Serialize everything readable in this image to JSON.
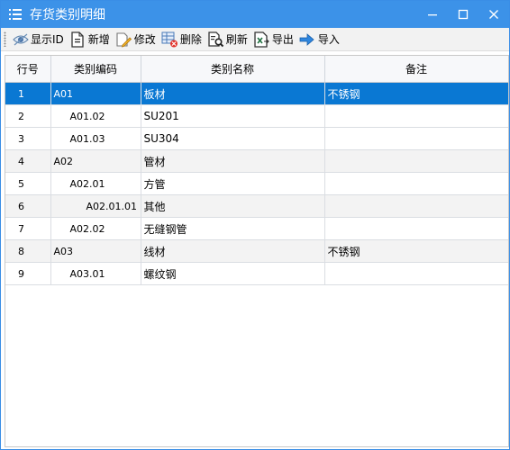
{
  "window": {
    "title": "存货类别明细",
    "accent": "#3c92e8"
  },
  "toolbar": {
    "show_id": "显示ID",
    "add": "新增",
    "edit": "修改",
    "delete": "删除",
    "refresh": "刷新",
    "export": "导出",
    "import": "导入"
  },
  "grid": {
    "columns": [
      "行号",
      "类别编码",
      "类别名称",
      "备注"
    ],
    "selected_color": "#0a78d3",
    "rows": [
      {
        "no": "1",
        "code": "A01",
        "name": "板材",
        "note": "不锈钢"
      },
      {
        "no": "2",
        "code": "A01.02",
        "name": "SU201",
        "note": ""
      },
      {
        "no": "3",
        "code": "A01.03",
        "name": "SU304",
        "note": ""
      },
      {
        "no": "4",
        "code": "A02",
        "name": "管材",
        "note": ""
      },
      {
        "no": "5",
        "code": "A02.01",
        "name": "方管",
        "note": ""
      },
      {
        "no": "6",
        "code": "A02.01.01",
        "name": "其他",
        "note": ""
      },
      {
        "no": "7",
        "code": "A02.02",
        "name": "无缝钢管",
        "note": ""
      },
      {
        "no": "8",
        "code": "A03",
        "name": "线材",
        "note": "不锈钢"
      },
      {
        "no": "9",
        "code": "A03.01",
        "name": "螺纹钢",
        "note": ""
      }
    ]
  }
}
